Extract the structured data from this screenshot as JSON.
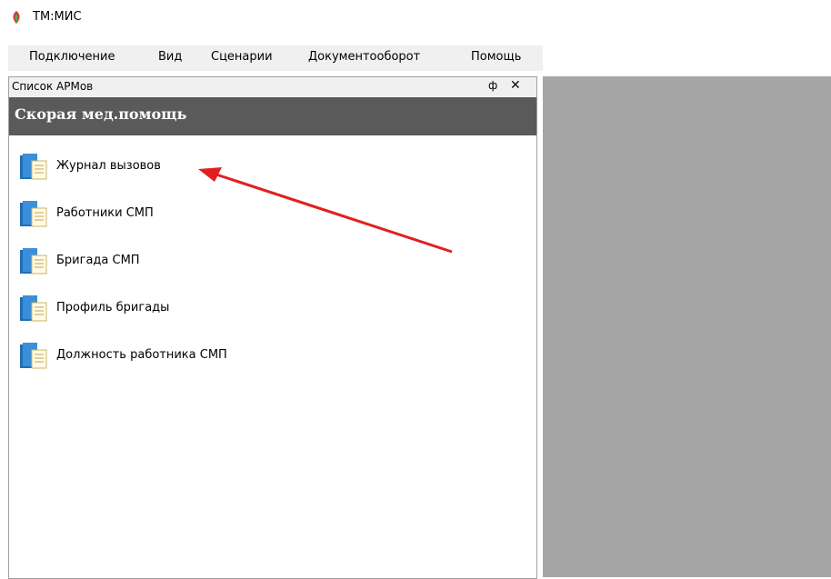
{
  "window": {
    "title": "ТМ:МИС"
  },
  "menu": {
    "items": [
      "Подключение",
      "Вид",
      "Сценарии",
      "Документооборот",
      "Помощь"
    ]
  },
  "panel": {
    "title": "Список АРМов",
    "pin_glyph": "ф",
    "close_glyph": "✕",
    "group_title": "Скорая мед.помощь",
    "items": [
      {
        "label": "Журнал вызовов"
      },
      {
        "label": "Работники СМП"
      },
      {
        "label": "Бригада СМП"
      },
      {
        "label": "Профиль бригады"
      },
      {
        "label": "Должность работника СМП"
      }
    ]
  },
  "colors": {
    "group_header_bg": "#5a5a5a",
    "workspace_bg": "#a6a6a6",
    "arrow": "#e02020"
  }
}
